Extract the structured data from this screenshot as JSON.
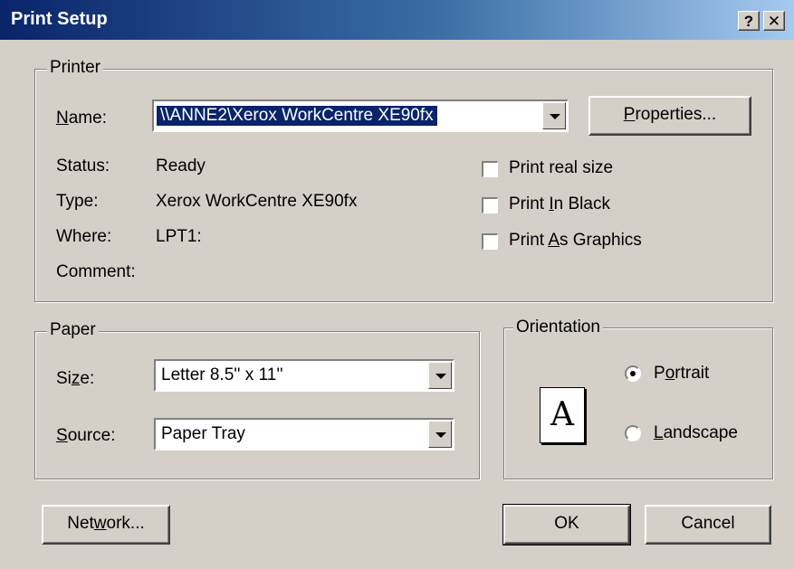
{
  "window": {
    "title": "Print Setup",
    "help_glyph": "?",
    "close_glyph": "✕"
  },
  "printer": {
    "legend": "Printer",
    "name_label": "Name:",
    "name_value": "\\\\ANNE2\\Xerox WorkCentre XE90fx",
    "properties_label": "Properties...",
    "status_label": "Status:",
    "status_value": "Ready",
    "type_label": "Type:",
    "type_value": "Xerox WorkCentre XE90fx",
    "where_label": "Where:",
    "where_value": "LPT1:",
    "comment_label": "Comment:",
    "comment_value": "",
    "options": [
      {
        "label": "Print real size",
        "checked": false
      },
      {
        "label": "Print In Black",
        "checked": false
      },
      {
        "label": "Print As Graphics",
        "checked": false
      }
    ]
  },
  "paper": {
    "legend": "Paper",
    "size_label": "Size:",
    "size_value": "Letter 8.5'' x 11''",
    "source_label": "Source:",
    "source_value": "Paper Tray"
  },
  "orientation": {
    "legend": "Orientation",
    "icon_letter": "A",
    "portrait_label": "Portrait",
    "landscape_label": "Landscape",
    "selected": "Portrait"
  },
  "buttons": {
    "network": "Network...",
    "ok": "OK",
    "cancel": "Cancel"
  }
}
